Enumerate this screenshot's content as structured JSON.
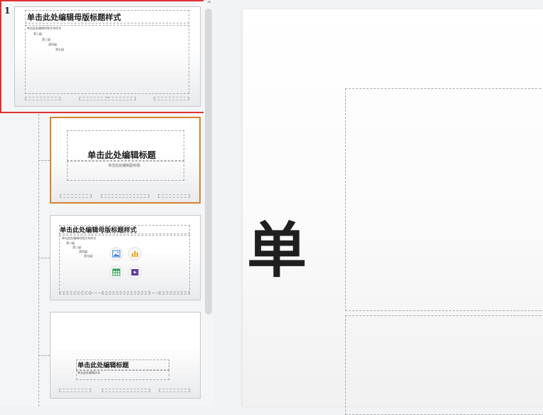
{
  "slide_number": "1",
  "master": {
    "title": "单击此处编辑母版标题样式",
    "levels": [
      "单击此处编辑母版文本样式",
      "第二级",
      "第三级",
      "第四级",
      "第五级"
    ],
    "footer_center": "‹#›"
  },
  "layout_title": {
    "title": "单击此处编辑标题",
    "subtitle": "单击此处编辑副标题"
  },
  "layout_content": {
    "title": "单击此处编辑母版标题样式",
    "levels": [
      "单击此处编辑母版文本样式",
      "第二级",
      "第三级",
      "第四级",
      "第五级"
    ],
    "icons": [
      "picture-icon",
      "chart-icon",
      "table-icon",
      "video-icon"
    ]
  },
  "layout_section": {
    "title": "单击此处编辑标题",
    "text": "单击此处编辑文本"
  },
  "canvas": {
    "title_char": "单"
  },
  "colors": {
    "selection": "#e03131",
    "active_layout_border": "#d9822b"
  }
}
